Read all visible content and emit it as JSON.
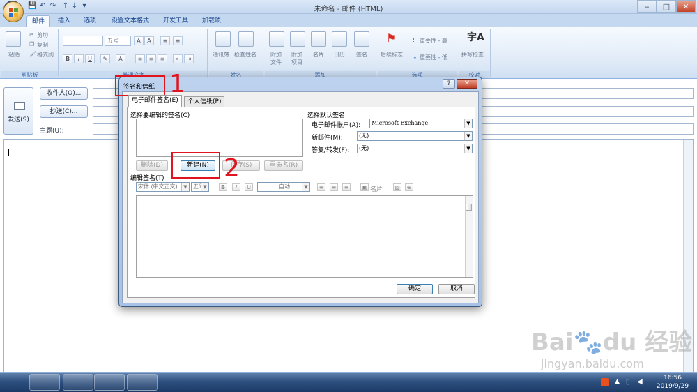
{
  "window": {
    "title": "未命名 - 邮件 (HTML)",
    "minimize": "‒",
    "maximize": "□",
    "close": "✕"
  },
  "quick_access": [
    "💾",
    "↶",
    "↷",
    "↑",
    "↓",
    "▾"
  ],
  "tabs": [
    "邮件",
    "插入",
    "选项",
    "设置文本格式",
    "开发工具",
    "加载项"
  ],
  "ribbon": {
    "clipboard": {
      "cut": "剪切",
      "copy": "复制",
      "format_painter": "格式刷",
      "paste": "粘贴",
      "label": "剪贴板"
    },
    "basic_text": {
      "font_size": "五号",
      "label": "普通文本"
    },
    "names": {
      "address_book": "通讯簿",
      "check_names": "检查姓名",
      "label": "姓名"
    },
    "include": {
      "attach_file": [
        "附加",
        "文件"
      ],
      "attach_item": [
        "附加",
        "项目"
      ],
      "business_card": "名片",
      "calendar": "日历",
      "signature": "签名",
      "label": "添加"
    },
    "options": {
      "follow_up": "后续标志",
      "importance_high": "重要性 - 高",
      "importance_low": "重要性 - 低",
      "label": "选项"
    },
    "proofing": {
      "spelling": "拼写检查",
      "label": "校对"
    }
  },
  "compose": {
    "to_button": "收件人(O)...",
    "cc_button": "抄送(C)...",
    "subject_label": "主题(U):",
    "send_button": "发送(S)"
  },
  "dialog": {
    "title": "签名和信纸",
    "help": "?",
    "close": "✕",
    "tabs": [
      "电子邮件签名(E)",
      "个人信纸(P)"
    ],
    "select_label": "选择要编辑的签名(C)",
    "buttons": {
      "delete": "删除(D)",
      "new": "新建(N)",
      "save": "保存(S)",
      "rename": "重命名(R)"
    },
    "default_sig_label": "选择默认签名",
    "account_label": "电子邮件帐户(A):",
    "account_value": "Microsoft Exchange",
    "new_msg_label": "新邮件(M):",
    "new_msg_value": "(无)",
    "reply_label": "答复/转发(F):",
    "reply_value": "(无)",
    "edit_label": "编辑签名(T)",
    "font_name": "宋体 (中文正文)",
    "font_size": "五号",
    "bold": "B",
    "italic": "I",
    "underline": "U",
    "color": "自动",
    "business_card": "名片",
    "ok": "确定",
    "cancel": "取消"
  },
  "annotations": {
    "step1": "1",
    "step2": "2"
  },
  "taskbar": {
    "time": "16:56",
    "date": "2019/9/29"
  },
  "watermark": {
    "line1": "Bai🐾du 经验",
    "line2": "jingyan.baidu.com"
  },
  "colors": {
    "accent": "#15428b",
    "highlight": "#e0141e"
  }
}
